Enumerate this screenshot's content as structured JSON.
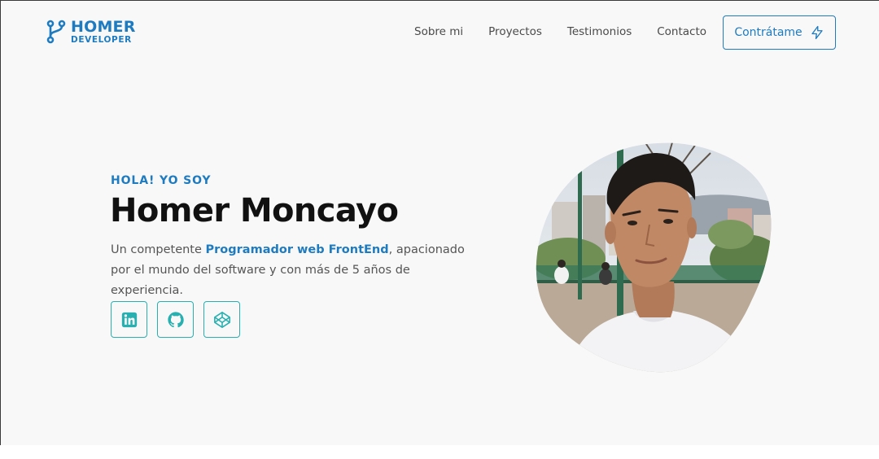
{
  "brand": {
    "top": "HOMER",
    "bottom": "DEVELOPER",
    "color": "#1f7bbf",
    "icon": "git-branch-icon"
  },
  "nav": {
    "items": [
      {
        "label": "Sobre mi"
      },
      {
        "label": "Proyectos"
      },
      {
        "label": "Testimonios"
      },
      {
        "label": "Contacto"
      }
    ]
  },
  "cta": {
    "label": "Contrátame",
    "icon": "lightning-icon"
  },
  "hero": {
    "eyebrow": "HOLA! YO SOY",
    "name": "Homer Moncayo",
    "desc_before": "Un competente ",
    "desc_highlight": "Programador web FrontEnd",
    "desc_after": ", apacionado por el mundo del software y con más de 5 años de experiencia.",
    "photo": "profile-photo"
  },
  "socials": [
    {
      "icon": "linkedin-icon"
    },
    {
      "icon": "github-icon"
    },
    {
      "icon": "codepen-icon"
    }
  ],
  "colors": {
    "accent": "#1f7bbf",
    "teal": "#28b0b0",
    "background": "#f8f8f9"
  }
}
